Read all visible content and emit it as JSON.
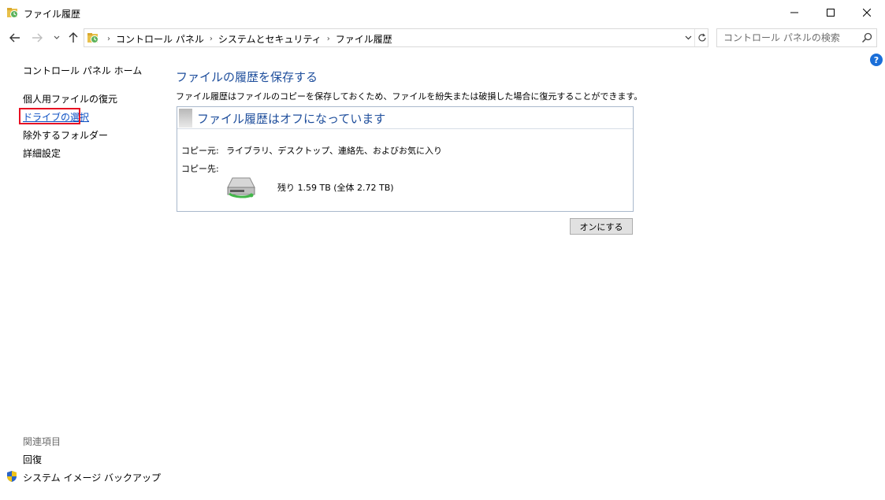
{
  "window": {
    "title": "ファイル履歴"
  },
  "address": {
    "crumbs": [
      "コントロール パネル",
      "システムとセキュリティ",
      "ファイル履歴"
    ],
    "search_placeholder": "コントロール パネルの検索"
  },
  "sidebar": {
    "home": "コントロール パネル ホーム",
    "items": [
      "個人用ファイルの復元",
      "ドライブの選択",
      "除外するフォルダー",
      "詳細設定"
    ],
    "related_title": "関連項目",
    "related_items": [
      "回復",
      "システム イメージ バックアップ"
    ]
  },
  "main": {
    "heading": "ファイルの履歴を保存する",
    "description": "ファイル履歴はファイルのコピーを保存しておくため、ファイルを紛失または破損した場合に復元することができます。",
    "status_title": "ファイル履歴はオフになっています",
    "copy_from_label": "コピー元:",
    "copy_from_value": "ライブラリ、デスクトップ、連絡先、およびお気に入り",
    "copy_to_label": "コピー先:",
    "drive_space": "残り 1.59 TB (全体 2.72 TB)",
    "turn_on_button": "オンにする"
  },
  "colors": {
    "heading": "#1e4e9c",
    "link": "#0b4fc3",
    "highlight": "#e81123",
    "help": "#1a6ed8"
  },
  "icons": [
    "file-history-icon",
    "back-arrow-icon",
    "forward-arrow-icon",
    "recent-dropdown-icon",
    "up-arrow-icon",
    "chevron-right-icon",
    "refresh-icon",
    "search-icon",
    "help-icon",
    "drive-icon",
    "shield-icon"
  ]
}
